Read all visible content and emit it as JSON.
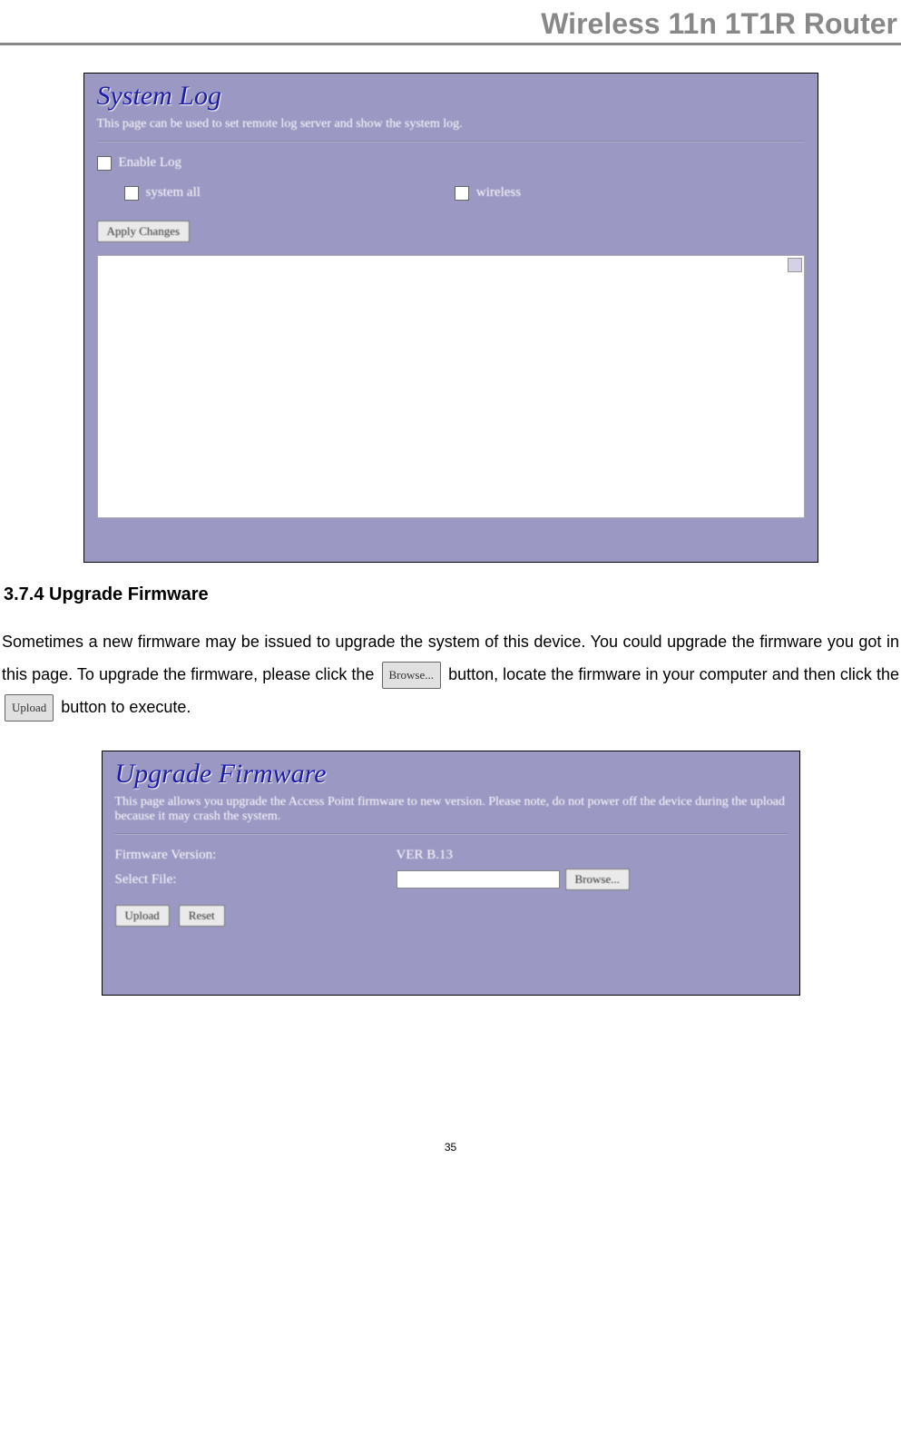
{
  "header": {
    "title": "Wireless 11n 1T1R Router"
  },
  "systemLog": {
    "title": "System Log",
    "description": "This page can be used to set remote log server and show the system log.",
    "enableLabel": "Enable Log",
    "systemAllLabel": "system all",
    "wirelessLabel": "wireless",
    "applyButton": "Apply Changes"
  },
  "section": {
    "number": "3.7.4",
    "title": "Upgrade Firmware",
    "body1": "Sometimes a new firmware may be issued to upgrade the system of this device. You could upgrade the firmware you got in this page. To upgrade the firmware, please click the ",
    "browseBtn": "Browse...",
    "body2": "button, locate the firmware in your computer and then click the ",
    "uploadBtn": "Upload",
    "body3": " button to execute."
  },
  "upgradeFirmware": {
    "title": "Upgrade Firmware",
    "description": "This page allows you upgrade the Access Point firmware to new version. Please note, do not power off the device during the upload because it may crash the system.",
    "versionLabel": "Firmware Version:",
    "versionValue": "VER B.13",
    "selectFileLabel": "Select File:",
    "browseButton": "Browse...",
    "uploadButton": "Upload",
    "resetButton": "Reset"
  },
  "pageNumber": "35"
}
